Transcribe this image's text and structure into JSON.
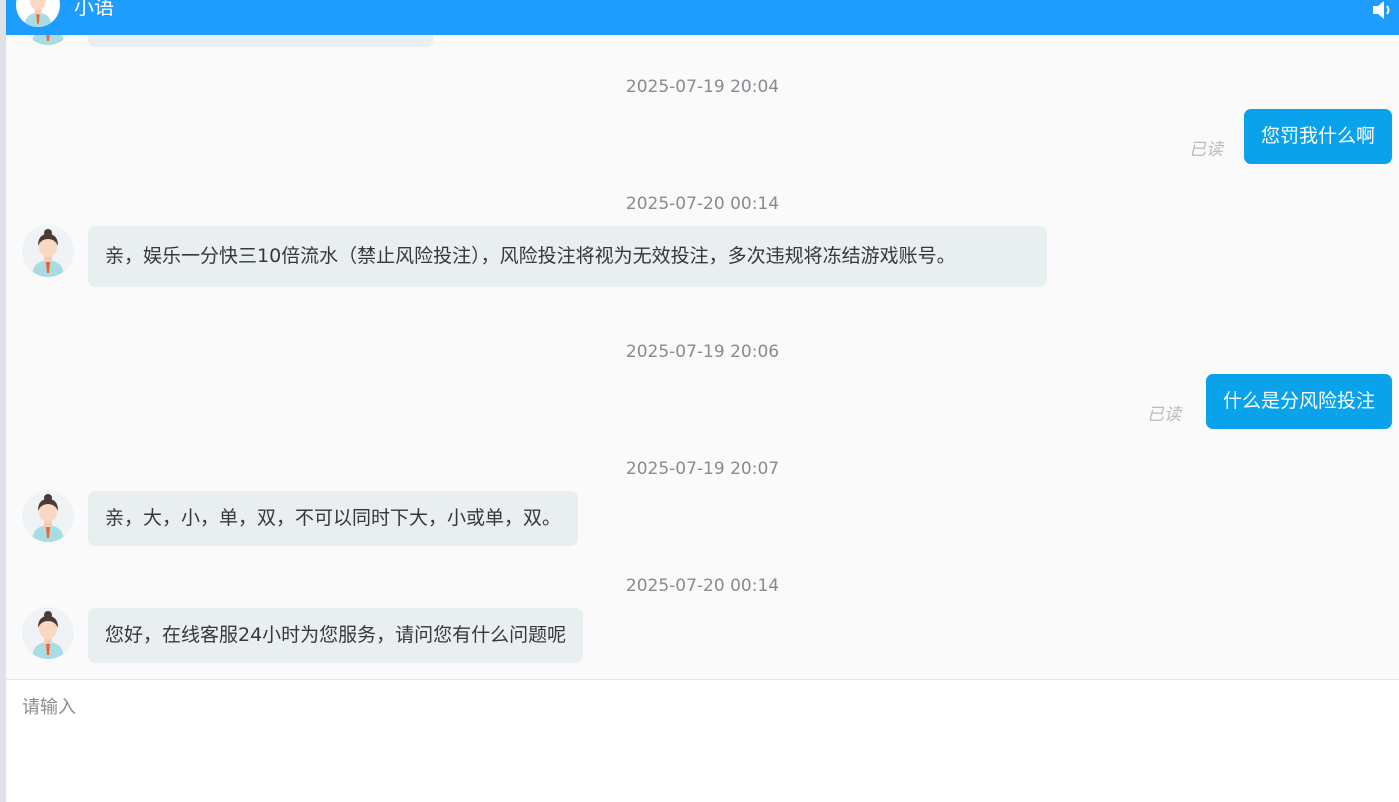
{
  "header": {
    "title": "小语"
  },
  "colors": {
    "header_bg": "#1e9dff",
    "bubble_out": "#0ba2ec",
    "bubble_in": "#e9eef0"
  },
  "messages": [
    {
      "time": "2025-07-19 20:04",
      "direction": "out",
      "text": "您罚我什么啊",
      "status": "已读"
    },
    {
      "time": "2025-07-20 00:14",
      "direction": "in",
      "text": "亲，娱乐一分快三10倍流水（禁止风险投注），风险投注将视为无效投注，多次违规将冻结游戏账号。"
    },
    {
      "time": "2025-07-19 20:06",
      "direction": "out",
      "text": "什么是分风险投注",
      "status": "已读"
    },
    {
      "time": "2025-07-19 20:07",
      "direction": "in",
      "text": "亲，大，小，单，双，不可以同时下大，小或单，双。"
    },
    {
      "time": "2025-07-20 00:14",
      "direction": "in",
      "text": "您好，在线客服24小时为您服务，请问您有什么问题呢"
    }
  ],
  "input": {
    "placeholder": "请输入"
  }
}
